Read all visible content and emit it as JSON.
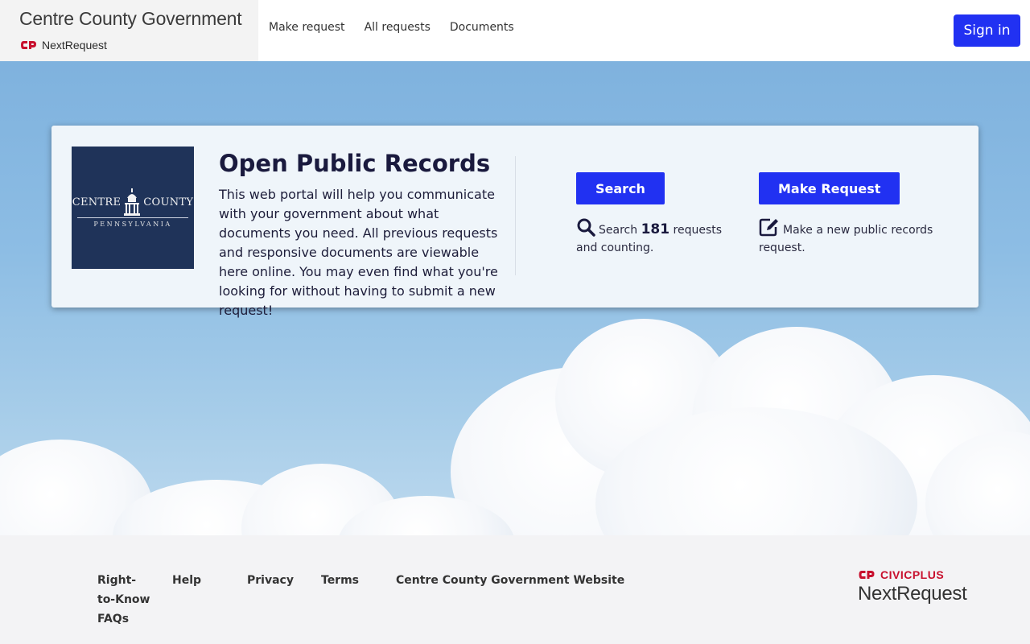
{
  "header": {
    "brand_title": "Centre County Government",
    "brand_sub": "NextRequest",
    "nav": [
      "Make request",
      "All requests",
      "Documents"
    ],
    "signin_label": "Sign in"
  },
  "card": {
    "seal_word_left": "CENTRE",
    "seal_word_right": "COUNTY",
    "seal_sub": "PENNSYLVANIA",
    "title": "Open Public Records",
    "description": "This web portal will help you communicate with your government about what documents you need. All previous requests and responsive documents are viewable here online. You may even find what you're looking for without having to submit a new request!",
    "search": {
      "button": "Search",
      "text_before": "Search",
      "count": "181",
      "text_after": "requests and counting."
    },
    "make_request": {
      "button": "Make Request",
      "text": "Make a new public records request."
    }
  },
  "footer": {
    "links": [
      "Right-to-Know FAQs",
      "Help",
      "Privacy",
      "Terms",
      "Centre County Government Website"
    ],
    "civicplus": "CIVICPLUS",
    "nextrequest": "NextRequest"
  },
  "colors": {
    "accent": "#2131f2",
    "seal_bg": "#1f3359",
    "brand_red": "#c8102e"
  }
}
